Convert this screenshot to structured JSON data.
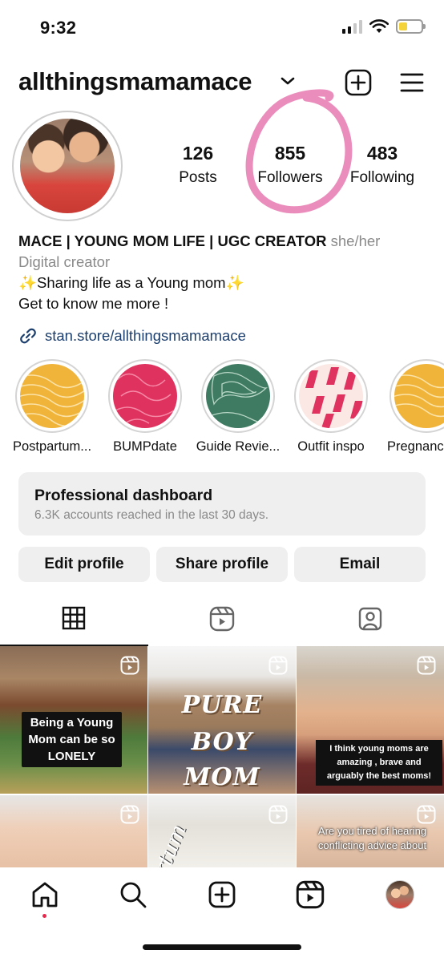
{
  "status": {
    "time": "9:32"
  },
  "header": {
    "username": "allthingsmamamace"
  },
  "stats": [
    {
      "value": "126",
      "label": "Posts"
    },
    {
      "value": "855",
      "label": "Followers"
    },
    {
      "value": "483",
      "label": "Following"
    }
  ],
  "bio": {
    "name": "MACE | YOUNG MOM LIFE | UGC CREATOR",
    "pronouns": "she/her",
    "category": "Digital creator",
    "line1": "✨Sharing life as a Young mom✨",
    "line2": "Get to know me more !",
    "link": "stan.store/allthingsmamamace"
  },
  "highlights": [
    {
      "label": "Postpartum..."
    },
    {
      "label": "BUMPdate"
    },
    {
      "label": "Guide Revie..."
    },
    {
      "label": "Outfit inspo"
    },
    {
      "label": "Pregnanc"
    }
  ],
  "dashboard": {
    "title": "Professional dashboard",
    "subtitle": "6.3K accounts reached in the last 30 days."
  },
  "actions": {
    "edit": "Edit profile",
    "share": "Share profile",
    "email": "Email"
  },
  "posts": {
    "p1_caption": "Being a Young Mom can be so LONELY",
    "p2_line1": "PURE",
    "p2_line2": "BOY",
    "p2_line3": "MOM",
    "p3_caption": "I think young moms are amazing , brave and arguably the best moms!",
    "p5_text": "rtum",
    "p6_text": "Are you tired of hearing conflicting advice about"
  },
  "colors": {
    "annotation": "#e879b0",
    "link": "#1c3f6e",
    "notification_dot": "#e8284d"
  }
}
